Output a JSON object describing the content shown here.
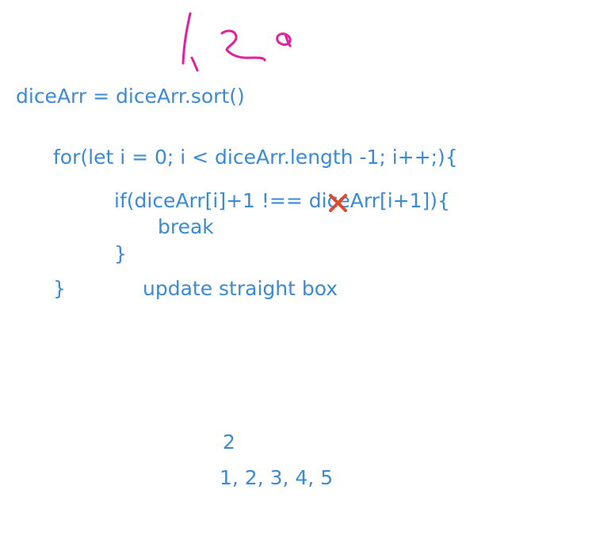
{
  "handwriting": {
    "top_note": "1, 2, 3",
    "color": "#e0219b"
  },
  "code": {
    "line1": "diceArr = diceArr.sort()",
    "line2": "for(let i = 0; i < diceArr.length -1; i++;){",
    "line3_prefix": "if(diceArr[i]+1 !==",
    "line3_suffix": " diceArr[i+1]){",
    "line4": "break",
    "line5": "}",
    "line6": "}",
    "line7": "update straight box",
    "text_color": "#3a8ad8"
  },
  "annotations": {
    "strike_mark": "x-mark-icon",
    "strike_color": "#e0492c"
  },
  "notes": {
    "value": "2",
    "sequence": "1, 2, 3, 4, 5"
  }
}
